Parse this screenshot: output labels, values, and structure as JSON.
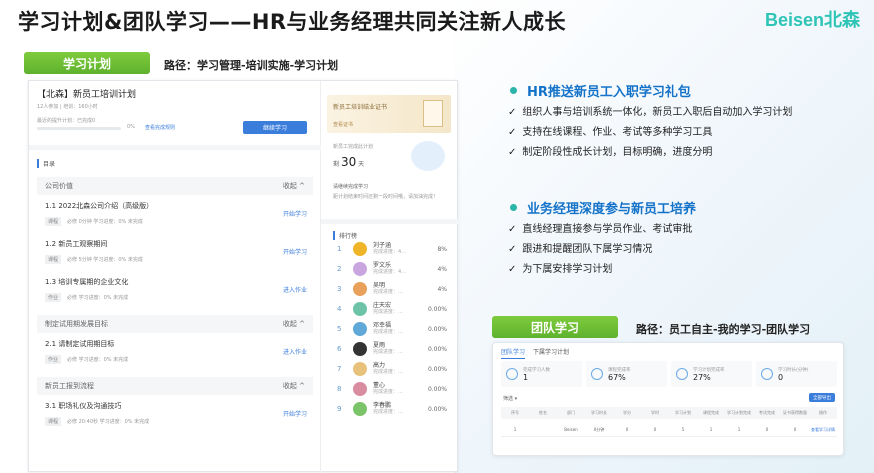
{
  "title": "学习计划&团队学习——HR与业务经理共同关注新人成长",
  "logo": "Beisen北森",
  "left": {
    "pill": "学习计划",
    "path": "路径：学习管理-培训实施-学习计划"
  },
  "plan": {
    "name": "【北森】新员工培训计划",
    "meta": "12人参加  |  培训：160小时",
    "progress_label": "最近的提升计划：已完成0",
    "progress_pct": "0%",
    "view_link": "查看完成规则",
    "start_button": "继续学习",
    "catalog_label": "目录",
    "sections": [
      {
        "name": "公司价值",
        "toggle": "收起 ^",
        "items": [
          {
            "title": "1.1  2022北森公司介绍（高级版）",
            "tag": "课程",
            "meta": "必修    0分钟    学习进度：0%    未完成",
            "action": "开始学习"
          },
          {
            "title": "1.2  新员工观察期间",
            "tag": "课程",
            "meta": "必修    5分钟    学习进度：0%    未完成",
            "action": "开始学习"
          },
          {
            "title": "1.3  培训专属期的企业文化",
            "tag": "作业",
            "meta": "必修    学习进度：0%    未完成",
            "action": "进入作业"
          }
        ]
      },
      {
        "name": "制定试用期发展目标",
        "toggle": "收起 ^",
        "items": [
          {
            "title": "2.1  请制定试用期目标",
            "tag": "作业",
            "meta": "必修    学习进度：0%    未完成",
            "action": "进入作业"
          }
        ]
      },
      {
        "name": "新员工报到流程",
        "toggle": "收起 ^",
        "items": [
          {
            "title": "3.1  职场礼仪及沟通技巧",
            "tag": "课程",
            "meta": "必修    20:40秒    学习进度：0%    未完成",
            "action": "开始学习"
          }
        ]
      }
    ],
    "cert_text": "新员工培训结业证书",
    "cert_sub": "查看证书",
    "days_label": "新员工完成此计划",
    "days_prefix": "剩",
    "days_value": "30",
    "days_unit": "天",
    "remind_title": "请继续完成学习",
    "remind_text": "距计划结束时间还剩一段时间哦，请加油完成！",
    "rank_title": "排行榜",
    "rank": [
      {
        "no": "1",
        "name": "刘子涵",
        "sub": "完成进度：4...",
        "pct": "8%",
        "color": "#f0b429"
      },
      {
        "no": "2",
        "name": "罗文乐",
        "sub": "完成进度：4...",
        "pct": "4%",
        "color": "#c9a6e0"
      },
      {
        "no": "3",
        "name": "吴明",
        "sub": "完成进度：...",
        "pct": "4%",
        "color": "#e8a05a"
      },
      {
        "no": "4",
        "name": "庄天宏",
        "sub": "完成进度：...",
        "pct": "0.00%",
        "color": "#6cc3a8"
      },
      {
        "no": "5",
        "name": "邓幸福",
        "sub": "完成进度：...",
        "pct": "0.00%",
        "color": "#5fa8d8"
      },
      {
        "no": "6",
        "name": "夏雨",
        "sub": "完成进度：...",
        "pct": "0.00%",
        "color": "#333333"
      },
      {
        "no": "7",
        "name": "高力",
        "sub": "完成进度：...",
        "pct": "0.00%",
        "color": "#e8c27a"
      },
      {
        "no": "8",
        "name": "董心",
        "sub": "完成进度：...",
        "pct": "0.00%",
        "color": "#d98ba0"
      },
      {
        "no": "9",
        "name": "李春鹏",
        "sub": "完成进度：...",
        "pct": "0.00%",
        "color": "#7cc46a"
      }
    ]
  },
  "hr": {
    "heading": "HR推送新员工入职学习礼包",
    "points": [
      "组织人事与培训系统一体化，新员工入职后自动加入学习计划",
      "支持在线课程、作业、考试等多种学习工具",
      "制定阶段性成长计划，目标明确，进度分明"
    ]
  },
  "mgr": {
    "heading": "业务经理深度参与新员工培养",
    "points": [
      "直线经理直接参与学员作业、考试审批",
      "跟进和提醒团队下属学习情况",
      "为下属安排学习计划"
    ]
  },
  "team": {
    "pill": "团队学习",
    "path": "路径：员工自主-我的学习-团队学习",
    "tabs": [
      "团队学习",
      "下属学习计划"
    ],
    "stats": [
      {
        "label": "完成学习人数",
        "value": "1"
      },
      {
        "label": "课程完成率",
        "value": "67%"
      },
      {
        "label": "学习计划完成率",
        "value": "27%"
      },
      {
        "label": "学习时长(分钟)",
        "value": "0"
      }
    ],
    "filter": "筛选 ▾",
    "export": "全部导出",
    "cols": [
      "序号",
      "姓名",
      "部门",
      "学习时长",
      "学分",
      "学时",
      "学习计划",
      "课程完成",
      "学习计划完成",
      "考试完成",
      "证书获得数量",
      "操作"
    ],
    "row": [
      "1",
      "",
      "Beisen",
      "0分钟",
      "0",
      "0",
      "5",
      "1",
      "1",
      "0",
      "0",
      "查看学习详情"
    ]
  },
  "colors": {
    "accent_green": "#6cbd34",
    "heading_blue": "#1473c9",
    "dot_teal": "#2bb5a8",
    "link_blue": "#3b7ddb"
  }
}
